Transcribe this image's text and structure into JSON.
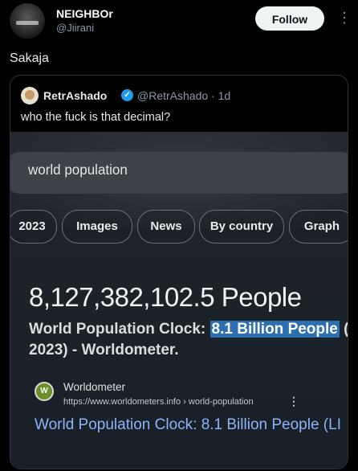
{
  "post": {
    "author_name": "NEIGHBOr",
    "author_handle": "@Jiirani",
    "follow_label": "Follow",
    "more_label": "⋮",
    "text": "Sakaja"
  },
  "quoted": {
    "author_name": "RetrAshado",
    "verified_mark": "✓",
    "handle_time": "@RetrAshado · 1d",
    "text": "who the fuck is that decimal?"
  },
  "photo": {
    "search_query": "world population",
    "chips": [
      "2023",
      "Images",
      "News",
      "By country",
      "Graph"
    ],
    "big_number": "8,127,382,102.5 People",
    "result_line1_prefix": "World Population Clock: ",
    "result_line1_highlight": "8.1 Billion People",
    "result_line1_suffix": " (L",
    "result_line2": "2023) - Worldometer.",
    "site_icon": "W",
    "site_name": "Worldometer",
    "site_url": "https://www.worldometers.info › world-population",
    "site_more": "⋮",
    "link_title": "World Population Clock: 8.1 Billion People (LI"
  }
}
